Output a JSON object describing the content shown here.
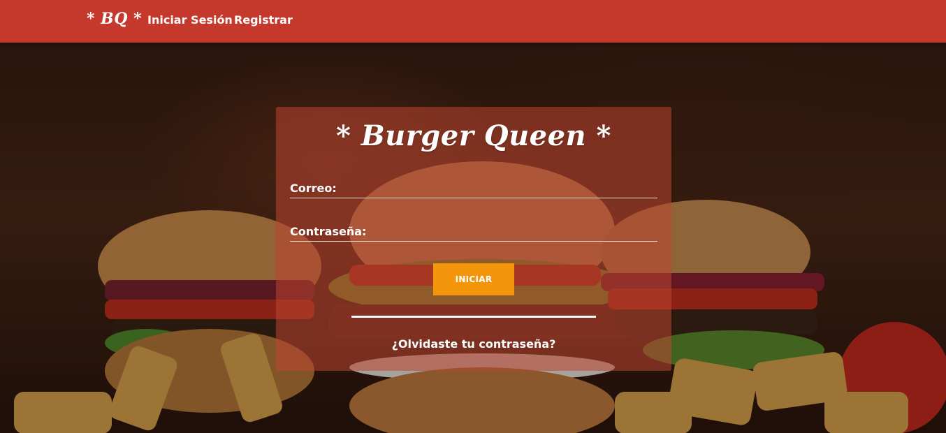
{
  "navbar": {
    "brand": "* BQ *",
    "links": [
      "Iniciar Sesión",
      "Registrar"
    ],
    "background_color": "#c4392b"
  },
  "login": {
    "title": "* Burger Queen *",
    "email_label": "Correo:",
    "email_value": "",
    "password_label": "Contraseña:",
    "password_value": "",
    "submit_label": "INICIAR",
    "forgot_link": "¿Olvidaste tu contraseña?",
    "button_color": "#f4960b"
  },
  "background": {
    "image": "burger-and-fries-photo"
  }
}
